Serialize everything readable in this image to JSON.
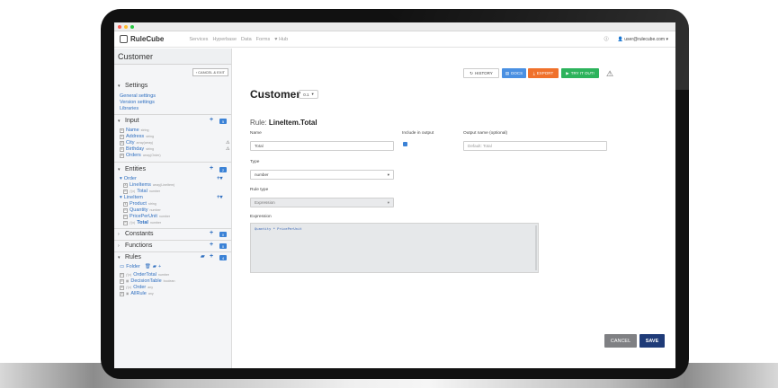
{
  "window": {
    "dots": [
      "#ff5f57",
      "#febc2e",
      "#28c840"
    ]
  },
  "app": {
    "name": "RuleCube",
    "nav": [
      "Services",
      "Hyperbase",
      "Data",
      "Forms",
      "Hub"
    ],
    "user": "user@rulecube.com"
  },
  "sidebar": {
    "title": "Customer",
    "cancel_exit": "CANCEL & EXIT",
    "settings": {
      "label": "Settings",
      "links": [
        "General settings",
        "Version settings",
        "Libraries"
      ]
    },
    "input": {
      "label": "Input",
      "count": "5",
      "items": [
        {
          "name": "Name",
          "type": "string"
        },
        {
          "name": "Address",
          "type": "string"
        },
        {
          "name": "City",
          "type": "array(array)"
        },
        {
          "name": "Birthday",
          "type": "string"
        },
        {
          "name": "Orders",
          "type": "array(Order)"
        }
      ]
    },
    "entities": {
      "label": "Entities",
      "count": "2",
      "order": {
        "label": "Order",
        "items": [
          {
            "name": "LineItems",
            "type": "array(LineItem)"
          },
          {
            "name": "Total",
            "type": "number"
          }
        ]
      },
      "lineitem": {
        "label": "LineItem",
        "items": [
          {
            "name": "Product",
            "type": "string"
          },
          {
            "name": "Quantity",
            "type": "number"
          },
          {
            "name": "PricePerUnit",
            "type": "number"
          },
          {
            "name": "Total",
            "type": "number"
          }
        ]
      }
    },
    "constants": {
      "label": "Constants",
      "count": "0"
    },
    "functions": {
      "label": "Functions",
      "count": "0"
    },
    "rules": {
      "label": "Rules",
      "count": "4",
      "folder": "Folder",
      "items": [
        {
          "name": "OrderTotal",
          "type": "number"
        },
        {
          "name": "DecisionTable",
          "type": "boolean"
        },
        {
          "name": "Order",
          "type": "any"
        },
        {
          "name": "AllRule",
          "type": "any"
        }
      ]
    }
  },
  "toolbar": {
    "history": "HISTORY",
    "docs": "DOCS",
    "export": "EXPORT",
    "try": "TRY IT OUT!"
  },
  "main": {
    "title": "Customer",
    "version": "0.1",
    "rule_prefix": "Rule:",
    "rule_name": "LineItem.Total",
    "name_label": "Name",
    "name_value": "Total",
    "include_label": "Include in output",
    "output_label": "Output name (optional)",
    "output_placeholder": "Default: Total",
    "type_label": "Type",
    "type_value": "number",
    "ruletype_label": "Rule type",
    "ruletype_value": "Expression",
    "expression_label": "Expression",
    "expression": "Quantity * PricePerUnit",
    "cancel": "CANCEL",
    "save": "SAVE"
  },
  "colors": {
    "docs": "#4a90e2",
    "export": "#f0712b",
    "try": "#2db35c",
    "save": "#1f3b78",
    "cancel": "#7f8083",
    "link": "#2f6fc0"
  }
}
